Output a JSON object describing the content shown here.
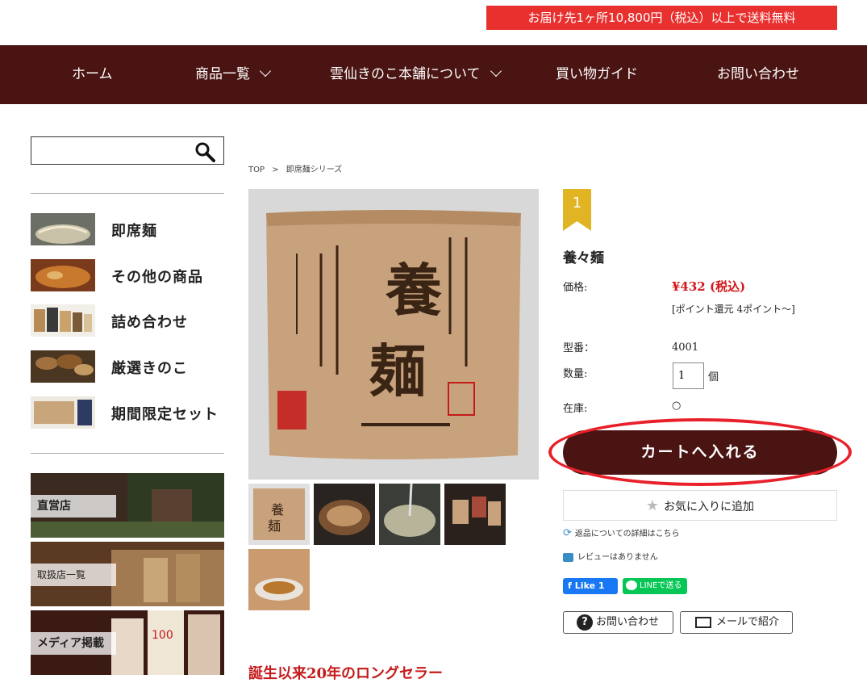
{
  "topbar": {
    "notice": "お届け先1ヶ所10,800円（税込）以上で送料無料"
  },
  "nav": {
    "items": [
      {
        "label": "ホーム"
      },
      {
        "label": "商品一覧"
      },
      {
        "label": "雲仙きのこ本舗について"
      },
      {
        "label": "買い物ガイド"
      },
      {
        "label": "お問い合わせ"
      }
    ]
  },
  "search": {
    "placeholder": ""
  },
  "sidebar": {
    "categories": [
      {
        "label": "即席麺"
      },
      {
        "label": "その他の商品"
      },
      {
        "label": "詰め合わせ"
      },
      {
        "label": "厳選きのこ"
      },
      {
        "label": "期間限定セット"
      }
    ],
    "banners": [
      {
        "label": "直営店"
      },
      {
        "label": "取扱店一覧"
      },
      {
        "label": "メディア掲載"
      }
    ]
  },
  "breadcrumb": {
    "top": "TOP",
    "sep": ">",
    "current": "即席麺シリーズ"
  },
  "product": {
    "rank": "1",
    "name": "養々麺",
    "price_label": "価格:",
    "price": "¥432 (税込)",
    "points": "[ポイント還元 4ポイント〜]",
    "model_label": "型番：",
    "model": "4001",
    "qty_label": "数量:",
    "qty_value": "1",
    "qty_unit": "個",
    "stock_label": "在庫:",
    "stock": "○",
    "cart_label": "カートへ入れる",
    "fav_label": "お気に入りに追加",
    "return_link": "返品についての詳細はこちら",
    "review_text": "レビューはありません",
    "fb_label": "Like 1",
    "line_label": "LINEで送る",
    "inquiry_label": "お問い合わせ",
    "mail_label": "メールで紹介"
  },
  "section": {
    "heading": "誕生以来20年のロングセラー"
  },
  "colors": {
    "brand": "#4a1412",
    "accent": "#e8312f",
    "price": "#d4161a"
  }
}
